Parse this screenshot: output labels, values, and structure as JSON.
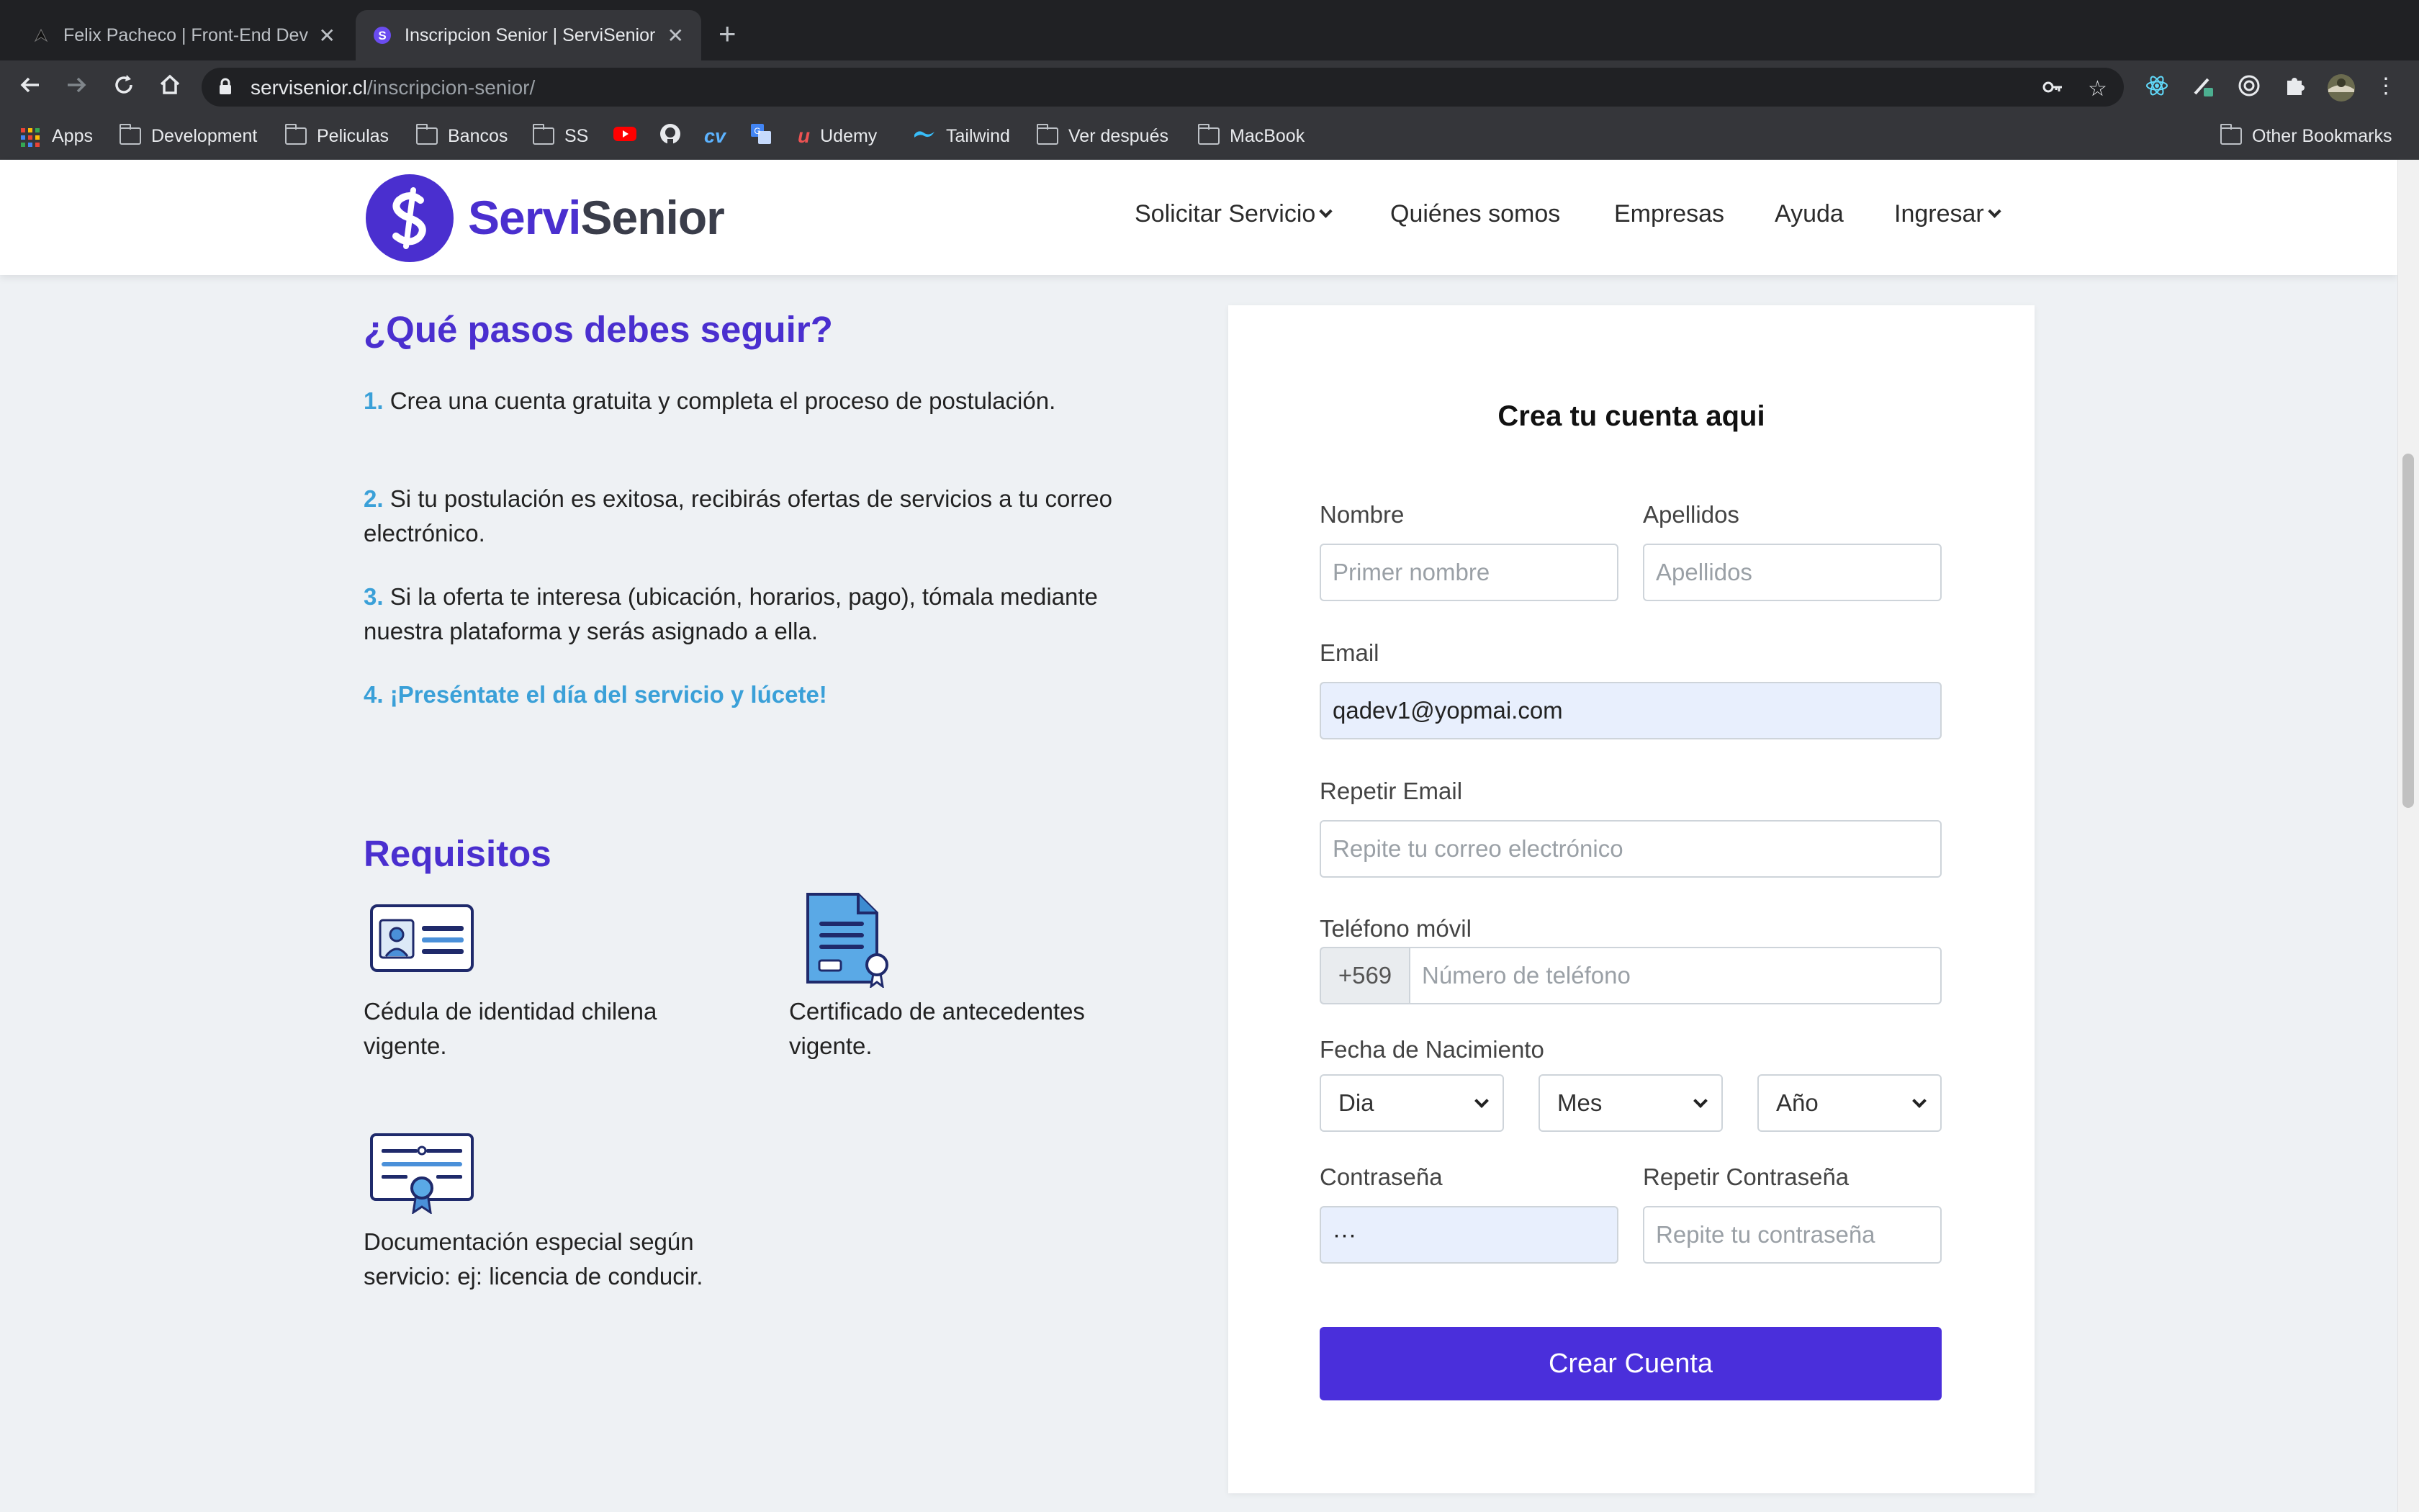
{
  "browser": {
    "tabs": [
      {
        "title": "Felix Pacheco | Front-End Developer",
        "active": false
      },
      {
        "title": "Inscripcion Senior | ServiSenior",
        "active": true
      }
    ],
    "url_host": "servisenior.cl",
    "url_path": "/inscripcion-senior/",
    "bookmarks": [
      "Apps",
      "Development",
      "Peliculas",
      "Bancos",
      "SS",
      "Udemy",
      "Tailwind",
      "Ver después",
      "MacBook"
    ],
    "other_bookmarks": "Other Bookmarks"
  },
  "header": {
    "logo_servi": "Servi",
    "logo_senior": "Senior",
    "nav": {
      "solicitar": "Solicitar Servicio",
      "quienes": "Quiénes somos",
      "empresas": "Empresas",
      "ayuda": "Ayuda",
      "ingresar": "Ingresar"
    }
  },
  "steps": {
    "title": "¿Qué pasos debes seguir?",
    "items": [
      {
        "num": "1.",
        "text": " Crea una cuenta gratuita y completa el proceso de postulación."
      },
      {
        "num": "2.",
        "text": " Si tu postulación es exitosa, recibirás ofertas de servicios a tu correo electrónico."
      },
      {
        "num": "3.",
        "text": " Si la oferta te interesa (ubicación, horarios, pago), tómala mediante nuestra plataforma y serás asignado a ella."
      },
      {
        "num": "4.",
        "text": " ¡Preséntate el día del servicio y lúcete!"
      }
    ]
  },
  "requisitos": {
    "title": "Requisitos",
    "items": [
      {
        "icon": "id-card-icon",
        "text": "Cédula de identidad chilena vigente."
      },
      {
        "icon": "certificate-document-icon",
        "text": "Certificado de antecedentes vigente."
      },
      {
        "icon": "diploma-icon",
        "text": "Documentación especial según servicio: ej: licencia de conducir."
      }
    ]
  },
  "form": {
    "title": "Crea tu cuenta aqui",
    "nombre_label": "Nombre",
    "nombre_placeholder": "Primer nombre",
    "apellidos_label": "Apellidos",
    "apellidos_placeholder": "Apellidos",
    "email_label": "Email",
    "email_value": "qadev1@yopmai.com",
    "repetir_email_label": "Repetir Email",
    "repetir_email_placeholder": "Repite tu correo electrónico",
    "telefono_label": "Teléfono móvil",
    "telefono_prefix": "+569",
    "telefono_placeholder": "Número de teléfono",
    "fecha_label": "Fecha de Nacimiento",
    "dia": "Dia",
    "mes": "Mes",
    "ano": "Año",
    "contrasena_label": "Contraseña",
    "contrasena_value": "···",
    "repetir_contrasena_label": "Repetir Contraseña",
    "repetir_contrasena_placeholder": "Repite tu contraseña",
    "submit": "Crear Cuenta"
  },
  "colors": {
    "brand_purple": "#4a2fcf",
    "step_blue": "#3aa0d8",
    "button": "#4a2fdb",
    "autofill": "#e8effd"
  }
}
